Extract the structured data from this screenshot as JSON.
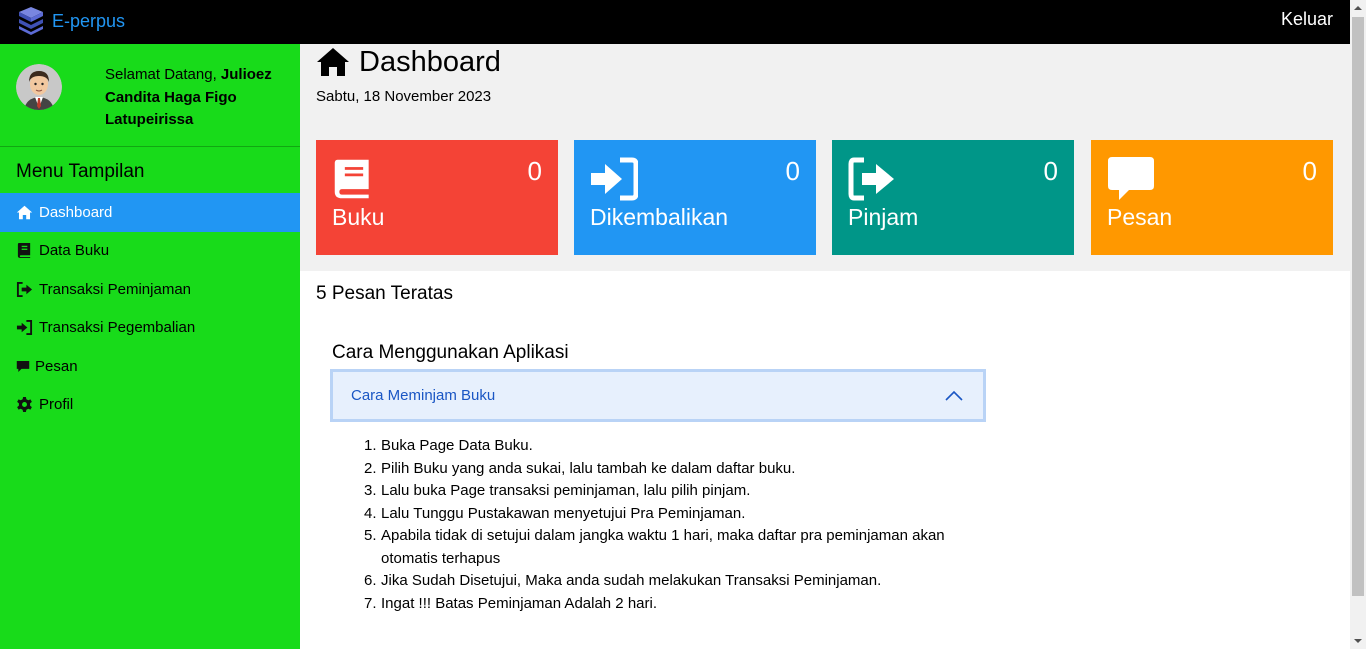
{
  "topbar": {
    "brand": "E-perpus",
    "logout": "Keluar"
  },
  "sidebar": {
    "welcome_prefix": "Selamat Datang,",
    "user_name": "Julioez Candita Haga Figo Latupeirissa",
    "menu_title": "Menu Tampilan",
    "items": [
      {
        "label": "Dashboard",
        "icon": "home-icon",
        "active": true
      },
      {
        "label": "Data Buku",
        "icon": "book-icon"
      },
      {
        "label": "Transaksi Peminjaman",
        "icon": "sign-out-icon"
      },
      {
        "label": "Transaksi Pegembalian",
        "icon": "sign-in-icon"
      },
      {
        "label": "Pesan",
        "icon": "comment-icon"
      },
      {
        "label": "Profil",
        "icon": "gear-icon"
      }
    ]
  },
  "main": {
    "title": "Dashboard",
    "date": "Sabtu, 18 November 2023",
    "cards": [
      {
        "label": "Buku",
        "count": "0",
        "color": "#f44336",
        "icon": "book-icon"
      },
      {
        "label": "Dikembalikan",
        "count": "0",
        "color": "#2196f3",
        "icon": "sign-in-icon"
      },
      {
        "label": "Pinjam",
        "count": "0",
        "color": "#009688",
        "icon": "sign-out-icon"
      },
      {
        "label": "Pesan",
        "count": "0",
        "color": "#ff9800",
        "icon": "comment-icon"
      }
    ],
    "top_messages_title": "5 Pesan Teratas",
    "howto_title": "Cara Menggunakan Aplikasi",
    "accordion_label": "Cara Meminjam Buku",
    "steps": [
      "Buka Page Data Buku.",
      "Pilih Buku yang anda sukai, lalu tambah ke dalam daftar buku.",
      "Lalu buka Page transaksi peminjaman, lalu pilih pinjam.",
      "Lalu Tunggu Pustakawan menyetujui Pra Peminjaman.",
      "Apabila tidak di setujui dalam jangka waktu 1 hari, maka daftar pra peminjaman akan otomatis terhapus",
      "Jika Sudah Disetujui, Maka anda sudah melakukan Transaksi Peminjaman.",
      "Ingat !!! Batas Peminjaman Adalah 2 hari."
    ]
  }
}
